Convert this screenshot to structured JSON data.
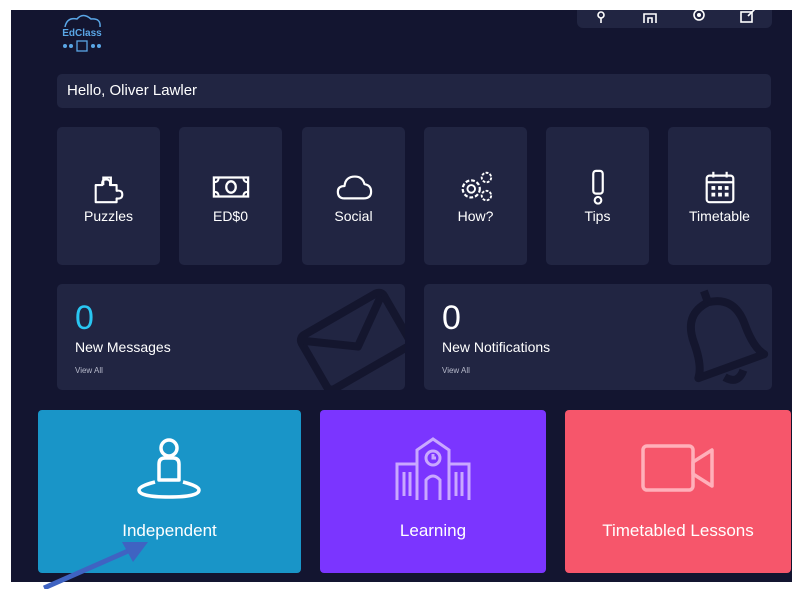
{
  "app": {
    "logo_text": "EdClass",
    "greeting": "Hello, Oliver Lawler",
    "topbar_icons": [
      "info-icon",
      "school-icon",
      "gear-icon",
      "edit-icon"
    ]
  },
  "tiles": [
    {
      "label": "Puzzles",
      "icon": "puzzle-icon"
    },
    {
      "label": "ED$0",
      "icon": "money-icon"
    },
    {
      "label": "Social",
      "icon": "cloud-icon"
    },
    {
      "label": "How?",
      "icon": "gears-icon"
    },
    {
      "label": "Tips",
      "icon": "exclamation-icon"
    },
    {
      "label": "Timetable",
      "icon": "calendar-icon"
    }
  ],
  "cards": [
    {
      "count": "0",
      "title": "New Messages",
      "link": "View All",
      "icon": "envelope-icon",
      "count_color": "#29c6f2"
    },
    {
      "count": "0",
      "title": "New Notifications",
      "link": "View All",
      "icon": "bell-icon",
      "count_color": "#ffffff"
    }
  ],
  "big_tiles": [
    {
      "label": "Independent",
      "icon": "person-pin-icon",
      "color": "#1995c8"
    },
    {
      "label": "Learning",
      "icon": "school-building-icon",
      "color": "#7b35ff"
    },
    {
      "label": "Timetabled Lessons",
      "icon": "video-camera-icon",
      "color": "#f6566b"
    }
  ],
  "colors": {
    "background": "#131530",
    "panel": "#212542",
    "arrow": "#3f63c2"
  }
}
